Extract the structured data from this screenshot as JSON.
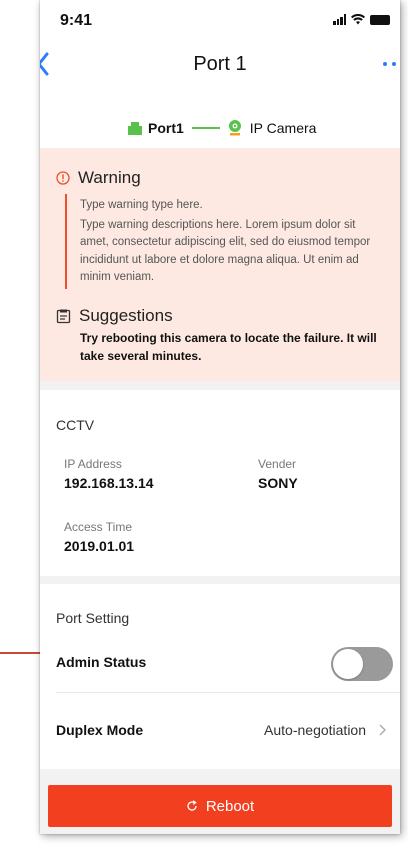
{
  "status_bar": {
    "time": "9:41"
  },
  "nav": {
    "title": "Port 1"
  },
  "connection": {
    "port_label": "Port1",
    "device_label": "IP Camera"
  },
  "warning": {
    "title": "Warning",
    "type_line": "Type warning type here.",
    "description": "Type warning descriptions here. Lorem ipsum dolor sit amet, consectetur adipiscing elit, sed do eiusmod tempor incididunt ut labore et dolore magna aliqua. Ut enim ad minim veniam."
  },
  "suggestions": {
    "title": "Suggestions",
    "text": "Try rebooting this camera to locate the failure. It will take several minutes."
  },
  "cctv": {
    "title": "CCTV",
    "ip_label": "IP Address",
    "ip_value": "192.168.13.14",
    "vendor_label": "Vender",
    "vendor_value": "SONY",
    "access_label": "Access Time",
    "access_value": "2019.01.01"
  },
  "port_setting": {
    "title": "Port Setting",
    "admin_label": "Admin Status",
    "admin_on": false,
    "duplex_label": "Duplex Mode",
    "duplex_value": "Auto-negotiation"
  },
  "reboot": {
    "label": "Reboot"
  },
  "colors": {
    "accent_red": "#f23f20",
    "link_blue": "#2b7cff",
    "online_green": "#58c24d",
    "warning_bg": "#fde9e1"
  },
  "icons": [
    "back-icon",
    "more-icon",
    "port-icon",
    "camera-icon",
    "warning-icon",
    "suggestion-icon",
    "chevron-right-icon",
    "refresh-icon"
  ]
}
